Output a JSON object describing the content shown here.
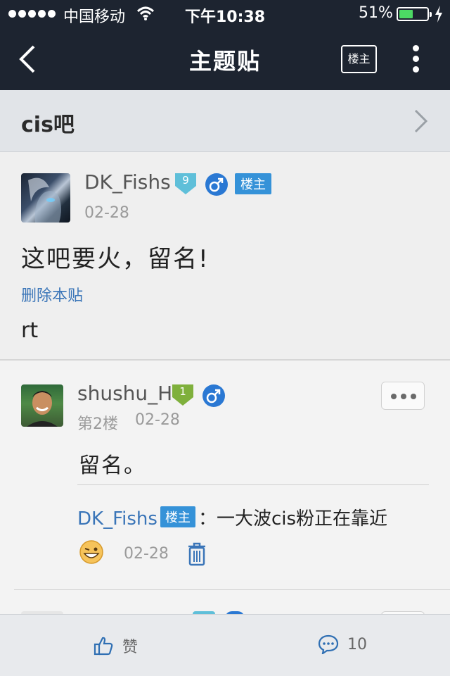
{
  "status_bar": {
    "carrier": "中国移动",
    "time": "下午10:38",
    "battery": "51%",
    "battery_level": 0.51
  },
  "nav": {
    "title": "主题贴",
    "op_only_button": "楼主"
  },
  "forum": {
    "name": "cis吧"
  },
  "main_post": {
    "author": "DK_Fishs",
    "level": "9",
    "gender": "♂",
    "op_tag": "楼主",
    "date": "02-28",
    "title": "这吧要火，留名!",
    "delete_link": "删除本贴",
    "body": "rt"
  },
  "floor_2": {
    "author": "shushu_H",
    "level": "1",
    "gender": "♂",
    "floor_label": "第2楼",
    "date": "02-28",
    "content": "留名。",
    "reply": {
      "author": "DK_Fishs",
      "op_tag": "楼主",
      "text": "：一大波cis粉正在靠近",
      "date": "02-28"
    }
  },
  "toolbar": {
    "like_label": "赞",
    "comment_count": "10"
  },
  "colors": {
    "header_bg": "#1d2430",
    "link_blue": "#3a75b8",
    "op_tag_blue": "#3592d8",
    "level9_badge": "#5fbfd9",
    "level1_badge": "#7fb03c",
    "battery_green": "#4cd964"
  }
}
